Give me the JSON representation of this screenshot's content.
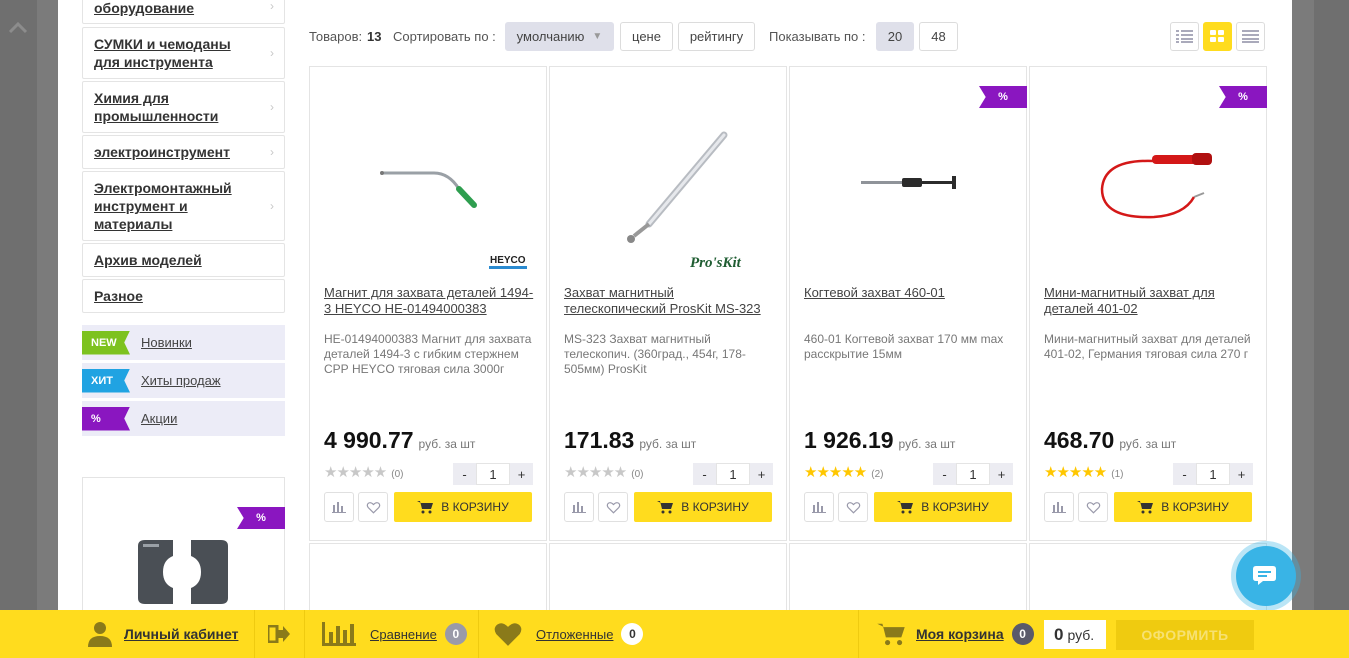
{
  "sidebar": {
    "categories": [
      {
        "label": "оборудование"
      },
      {
        "label": "СУМКИ и чемоданы для инструмента"
      },
      {
        "label": "Химия для промышленности"
      },
      {
        "label": "электроинструмент"
      },
      {
        "label": "Электромонтажный инструмент и материалы"
      },
      {
        "label": "Архив моделей"
      },
      {
        "label": "Разное"
      }
    ],
    "promos": [
      {
        "tag": "NEW",
        "label": "Новинки",
        "color": "#7dc21f"
      },
      {
        "tag": "ХИТ",
        "label": "Хиты продаж",
        "color": "#20a3e2"
      },
      {
        "tag": "%",
        "label": "Акции",
        "color": "#8a16c0"
      }
    ],
    "featured_flag": "%"
  },
  "toolbar": {
    "count_label": "Товаров:",
    "count_value": "13",
    "sort_label": "Сортировать по :",
    "sort_options": [
      "умолчанию",
      "цене",
      "рейтингу"
    ],
    "sort_active": "умолчанию",
    "show_label": "Показывать по :",
    "show_options": [
      "20",
      "48"
    ],
    "show_active": "20",
    "views": [
      "list-view-icon",
      "grid-view-icon",
      "table-view-icon"
    ],
    "view_active": "grid-view-icon"
  },
  "products": [
    {
      "name": "Магнит для захвата деталей 1494-3 HEYCO HE-01494000383",
      "desc": "HE-01494000383 Магнит для захвата деталей 1494-3 с гибким стержнем СРР HEYCO тяговая сила 3000г",
      "price": "4 990.77",
      "unit": "руб. за шт",
      "rating": 0,
      "rating_count": "(0)",
      "qty": "1",
      "brand": "HEYCO",
      "flag": ""
    },
    {
      "name": "Захват магнитный телескопический ProsKit MS-323",
      "desc": "MS-323 Захват магнитный телескопич. (360град., 454г, 178-505мм) ProsKit",
      "price": "171.83",
      "unit": "руб. за шт",
      "rating": 0,
      "rating_count": "(0)",
      "qty": "1",
      "brand": "Pro'sKit",
      "flag": ""
    },
    {
      "name": "Когтевой захват 460-01",
      "desc": "460-01 Когтевой захват 170 мм max расскрытие 15мм",
      "price": "1 926.19",
      "unit": "руб. за шт",
      "rating": 5,
      "rating_count": "(2)",
      "qty": "1",
      "brand": "",
      "flag": "%"
    },
    {
      "name": "Мини-магнитный захват для деталей 401-02",
      "desc": "Мини-магнитный захват для деталей 401-02, Германия тяговая сила 270 г",
      "price": "468.70",
      "unit": "руб. за шт",
      "rating": 5,
      "rating_count": "(1)",
      "qty": "1",
      "brand": "",
      "flag": "%"
    }
  ],
  "buttons": {
    "minus": "-",
    "plus": "+",
    "add_to_cart": "В КОРЗИНУ",
    "stars": "★★★★★"
  },
  "bottombar": {
    "account": "Личный кабинет",
    "compare": "Сравнение",
    "compare_count": "0",
    "wishlist": "Отложенные",
    "wishlist_count": "0",
    "cart": "Моя корзина",
    "cart_count": "0",
    "sum_value": "0",
    "sum_unit": "руб.",
    "checkout": "ОФОРМИТЬ"
  },
  "colors": {
    "accent": "#ffdc1e",
    "sale_flag": "#8a16c0",
    "chat": "#39b4e6"
  }
}
